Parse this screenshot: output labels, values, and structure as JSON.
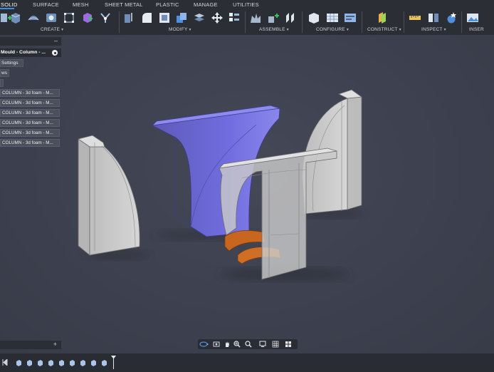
{
  "toolbar": {
    "tabs": [
      "SOLID",
      "SURFACE",
      "MESH",
      "SHEET METAL",
      "PLASTIC",
      "MANAGE",
      "UTILITIES"
    ],
    "groups": [
      "CREATE",
      "MODIFY",
      "ASSEMBLE",
      "CONFIGURE",
      "CONSTRUCT",
      "INSPECT",
      "INSER"
    ]
  },
  "browser": {
    "document_name": "Mould - Column - ...",
    "nodes": [
      "Settings",
      "ws"
    ],
    "items": [
      "COLUMN - 3d foam - M...",
      "COLUMN - 3d foam - M...",
      "COLUMN - 3d foam - M...",
      "COLUMN - 3d foam - M...",
      "COLUMN - 3d foam - M...",
      "COLUMN - 3d foam - M..."
    ]
  },
  "colors": {
    "viewport": "#3d4150",
    "toolbar": "#2c2e36",
    "selected_body": "#6a66d2",
    "gray_body": "#c8c8c8",
    "orange_body": "#c8651e"
  }
}
